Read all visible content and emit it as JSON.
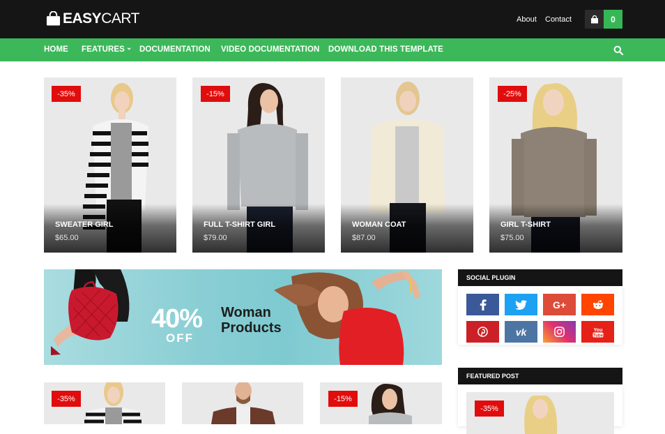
{
  "header": {
    "logo_bold": "EASY",
    "logo_thin": "CART",
    "links": [
      "About",
      "Contact"
    ],
    "cart_count": "0"
  },
  "nav": {
    "items": [
      "HOME",
      "FEATURES",
      "DOCUMENTATION",
      "VIDEO DOCUMENTATION",
      "DOWNLOAD THIS TEMPLATE"
    ],
    "features_caret": "⌄"
  },
  "products_top": [
    {
      "badge": "-35%",
      "name": "SWEATER GIRL",
      "price": "$65.00"
    },
    {
      "badge": "-15%",
      "name": "FULL T-SHIRT GIRL",
      "price": "$79.00"
    },
    {
      "badge": "",
      "name": "WOMAN COAT",
      "price": "$87.00"
    },
    {
      "badge": "-25%",
      "name": "GIRL T-SHIRT",
      "price": "$75.00"
    }
  ],
  "banner": {
    "percent": "40%",
    "off": "OFF",
    "line1": "Woman",
    "line2": "Products"
  },
  "sidebar": {
    "social_title": "SOCIAL PLUGIN",
    "social": [
      {
        "name": "facebook",
        "glyph": "f",
        "color": "#3b5998"
      },
      {
        "name": "twitter",
        "glyph": "🐦",
        "color": "#1da1f2"
      },
      {
        "name": "google-plus",
        "glyph": "G+",
        "color": "#dd4b39"
      },
      {
        "name": "reddit",
        "glyph": "●",
        "color": "#ff4500"
      },
      {
        "name": "pinterest",
        "glyph": "P",
        "color": "#cb2027"
      },
      {
        "name": "vk",
        "glyph": "vk",
        "color": "#4c75a3"
      },
      {
        "name": "instagram",
        "glyph": "◎",
        "color": "#c13584"
      },
      {
        "name": "youtube",
        "glyph": "You",
        "color": "#e62117"
      }
    ],
    "featured_title": "FEATURED POST",
    "featured_badge": "-35%"
  },
  "products_bottom": [
    {
      "badge": "-35%"
    },
    {
      "badge": ""
    },
    {
      "badge": "-15%"
    }
  ],
  "colors": {
    "accent": "#3cb85a",
    "badge": "#e10c0c",
    "dark": "#151515"
  }
}
